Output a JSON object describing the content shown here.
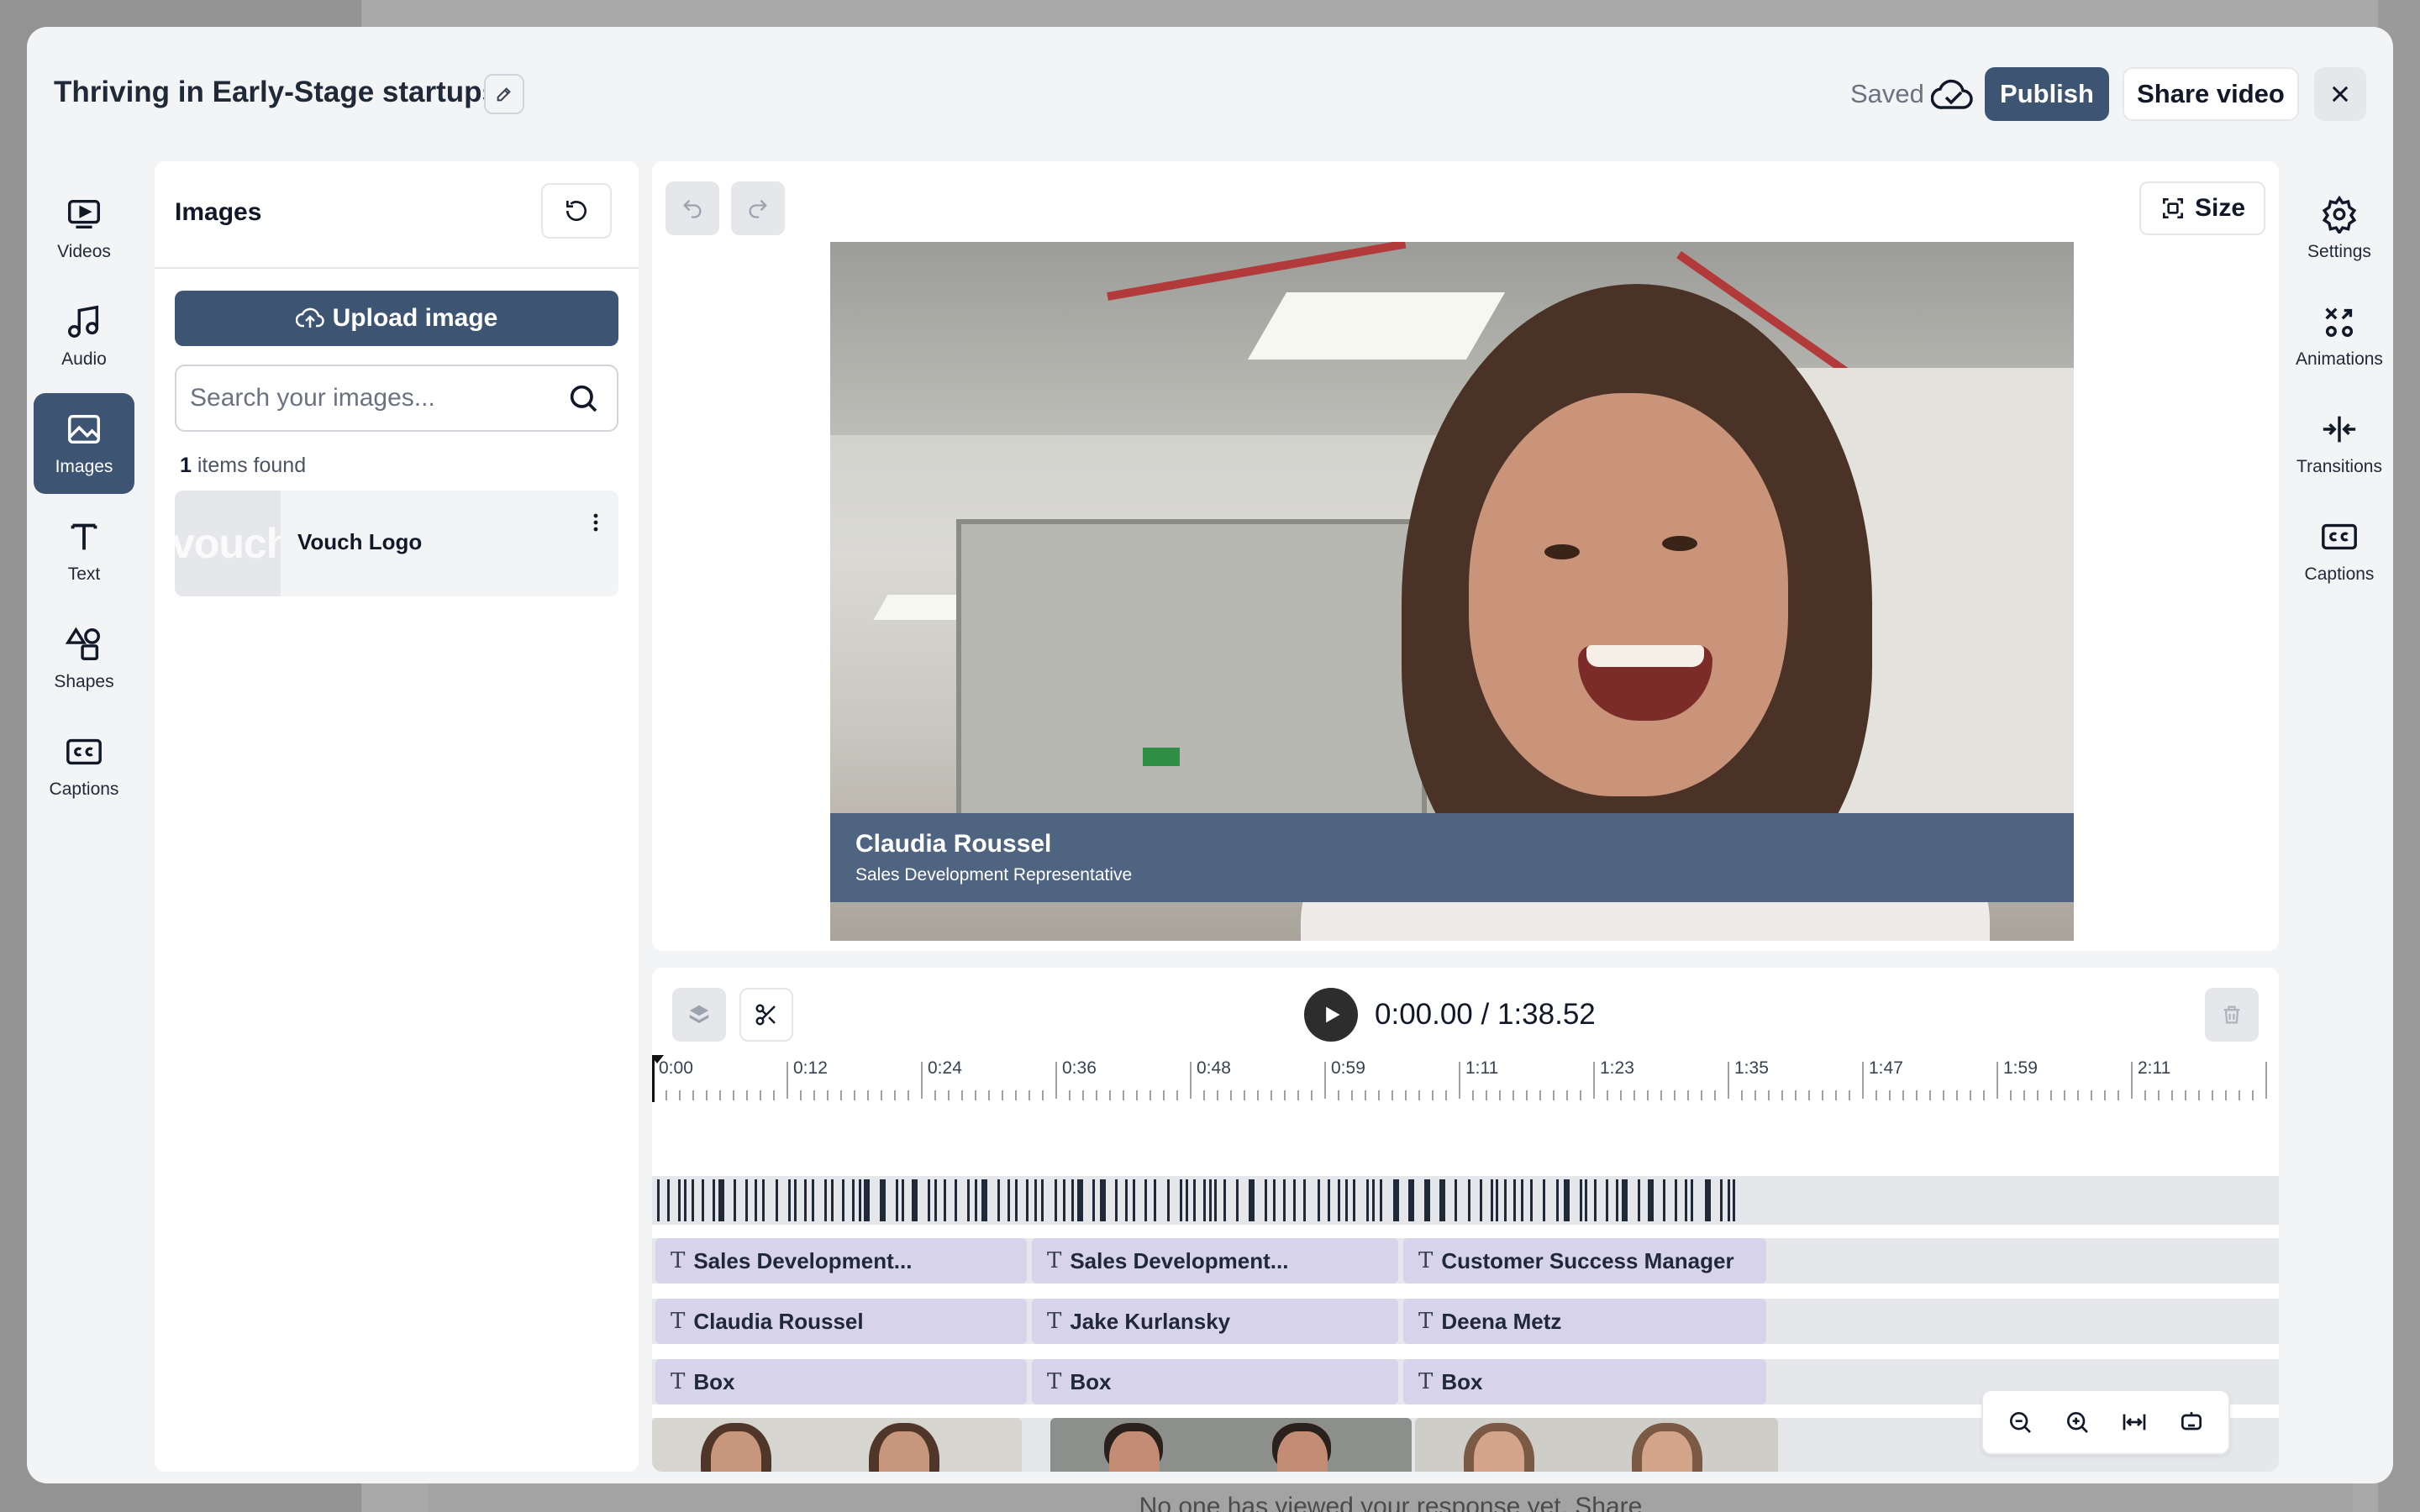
{
  "background": {
    "footer_text": "No one has viewed your response yet. Share"
  },
  "header": {
    "title": "Thriving in Early-Stage startups",
    "saved_label": "Saved",
    "publish_label": "Publish",
    "share_label": "Share video"
  },
  "left_rail": {
    "items": [
      {
        "label": "Videos",
        "icon": "video-icon"
      },
      {
        "label": "Audio",
        "icon": "music-icon"
      },
      {
        "label": "Images",
        "icon": "image-icon",
        "active": true
      },
      {
        "label": "Text",
        "icon": "text-icon"
      },
      {
        "label": "Shapes",
        "icon": "shapes-icon"
      },
      {
        "label": "Captions",
        "icon": "captions-icon"
      }
    ]
  },
  "images_panel": {
    "title": "Images",
    "upload_label": "Upload image",
    "search_placeholder": "Search your images...",
    "items_found_count": "1",
    "items_found_text": "items found",
    "items": [
      {
        "name": "Vouch Logo",
        "thumb_text": "vouch"
      }
    ]
  },
  "preview": {
    "size_label": "Size",
    "lower_third": {
      "name": "Claudia Roussel",
      "role": "Sales Development Representative"
    }
  },
  "right_rail": {
    "items": [
      {
        "label": "Settings",
        "icon": "gear-icon"
      },
      {
        "label": "Animations",
        "icon": "animations-icon"
      },
      {
        "label": "Transitions",
        "icon": "transitions-icon"
      },
      {
        "label": "Captions",
        "icon": "captions-icon"
      }
    ]
  },
  "timeline": {
    "current_time": "0:00.00",
    "separator": "/",
    "total_time": "1:38.52",
    "ruler_labels": [
      "0:00",
      "0:12",
      "0:24",
      "0:36",
      "0:48",
      "0:59",
      "1:11",
      "1:23",
      "1:35",
      "1:47",
      "1:59",
      "2:11"
    ],
    "tracks": [
      {
        "clips": [
          "Sales Development...",
          "Sales Development...",
          "Customer Success Manager"
        ]
      },
      {
        "clips": [
          "Claudia Roussel",
          "Jake Kurlansky",
          "Deena Metz"
        ]
      },
      {
        "clips": [
          "Box",
          "Box",
          "Box"
        ]
      }
    ]
  },
  "colors": {
    "accent": "#3d5473",
    "clip": "#d6d3ea",
    "lower_third": "#4f6480"
  }
}
